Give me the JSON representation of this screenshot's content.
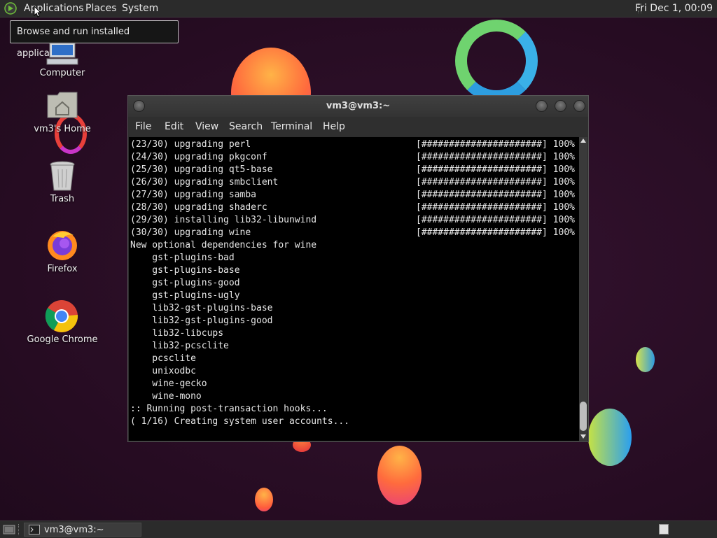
{
  "top_panel": {
    "menu_applications": "Applications",
    "menu_places": "Places",
    "menu_system": "System",
    "clock": "Fri Dec 1, 00:09"
  },
  "tooltip": "Browse and run installed applications",
  "desktop_icons": {
    "computer": "Computer",
    "home": "vm3's Home",
    "trash": "Trash",
    "firefox": "Firefox",
    "chrome": "Google Chrome"
  },
  "terminal": {
    "title": "vm3@vm3:~",
    "menu": [
      "File",
      "Edit",
      "View",
      "Search",
      "Terminal",
      "Help"
    ],
    "lines": [
      "(23/30) upgrading perl",
      "(24/30) upgrading pkgconf",
      "(25/30) upgrading qt5-base",
      "(26/30) upgrading smbclient",
      "(27/30) upgrading samba",
      "(28/30) upgrading shaderc",
      "(29/30) installing lib32-libunwind",
      "(30/30) upgrading wine",
      "New optional dependencies for wine",
      "    gst-plugins-bad",
      "    gst-plugins-base",
      "    gst-plugins-good",
      "    gst-plugins-ugly",
      "    lib32-gst-plugins-base",
      "    lib32-gst-plugins-good",
      "    lib32-libcups",
      "    lib32-pcsclite",
      "    pcsclite",
      "    unixodbc",
      "    wine-gecko",
      "    wine-mono",
      ":: Running post-transaction hooks...",
      "( 1/16) Creating system user accounts..."
    ],
    "progress_bar": "[######################] 100%"
  },
  "taskbar": {
    "window_button": "vm3@vm3:~"
  },
  "colors": {
    "desktop": "#2a0f26",
    "panel": "#2b2b2b",
    "terminal_bg": "#000000",
    "terminal_fg": "#e6e6e6"
  }
}
